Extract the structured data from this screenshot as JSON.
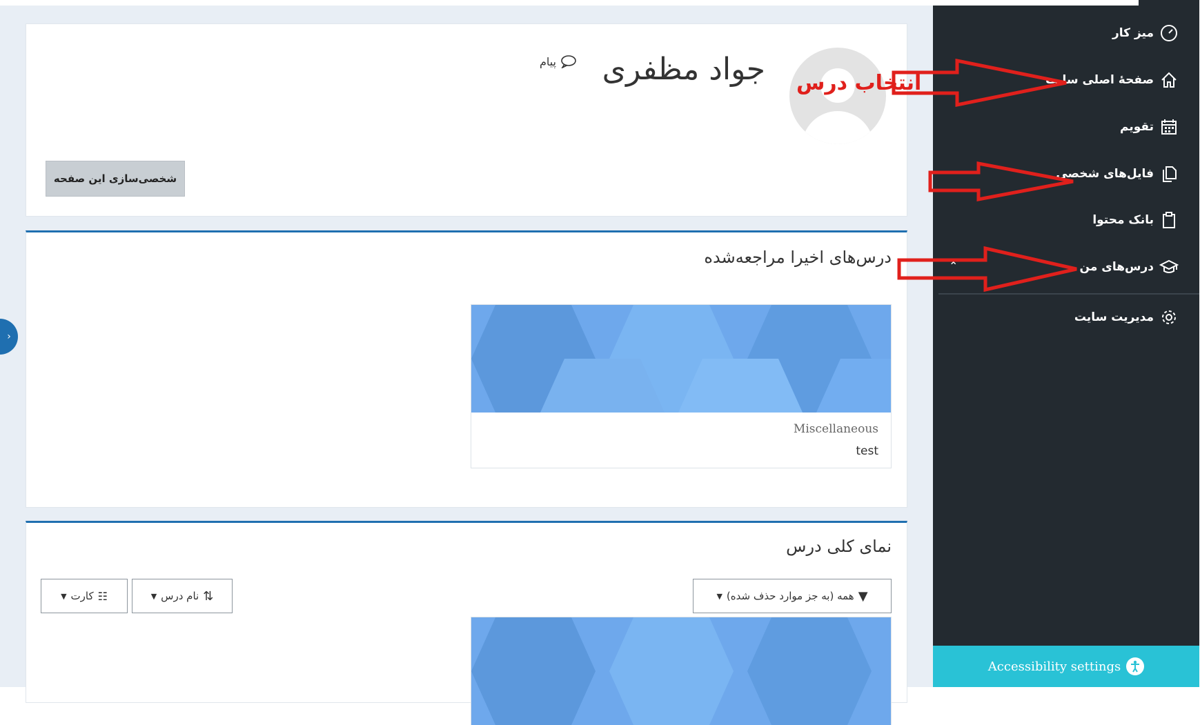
{
  "sidebar": {
    "items": [
      {
        "label": "میز کار",
        "icon": "gauge-icon"
      },
      {
        "label": "صفحهٔ اصلی سایت",
        "icon": "home-icon"
      },
      {
        "label": "تقویم",
        "icon": "calendar-icon"
      },
      {
        "label": "فایل‌های شخصی",
        "icon": "files-icon"
      },
      {
        "label": "بانک محتوا",
        "icon": "clipboard-icon"
      },
      {
        "label": "درس‌های من",
        "icon": "graduation-cap-icon"
      },
      {
        "label": "مدیریت سایت",
        "icon": "gear-icon"
      }
    ],
    "accessibility_label": "Accessibility settings"
  },
  "header": {
    "user_name": "جواد مظفری",
    "message_label": "پیام",
    "customize_button": "شخصی‌سازی این صفحه"
  },
  "annotation": {
    "label": "انتخاب درس",
    "color": "#e0201c"
  },
  "recent_courses": {
    "title": "درس‌های اخیرا مراجعه‌شده",
    "courses": [
      {
        "category": "Miscellaneous",
        "name": "test"
      }
    ]
  },
  "course_overview": {
    "title": "نمای کلی درس",
    "filter_label": "همه (به جز موارد حذف شده)",
    "sort_label": "نام درس",
    "view_label": "کارت"
  },
  "colors": {
    "sidebar_bg": "#232a30",
    "accent": "#1f6fb0",
    "accessibility_bg": "#29c2d6",
    "course_image": "#6ea8ec"
  }
}
